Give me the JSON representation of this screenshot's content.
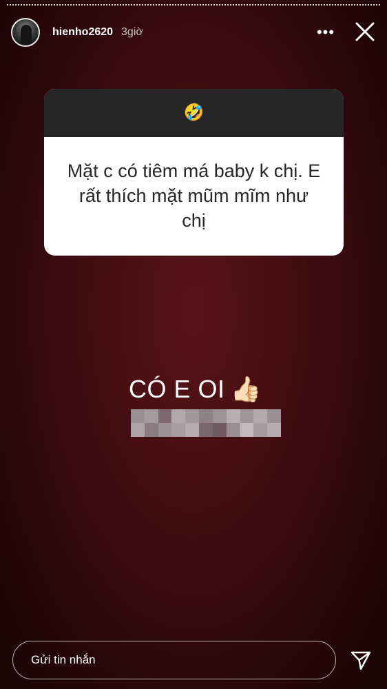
{
  "story": {
    "username": "hienho2620",
    "time": "3giờ",
    "more_label": "•••"
  },
  "question": {
    "emoji": "🤣",
    "text": "Mặt c có tiêm má baby k chị. E rất thích mặt mũm mĩm như chị"
  },
  "answer": {
    "text": "CÓ E OI",
    "emoji": "👍🏻"
  },
  "reply": {
    "placeholder": "Gửi tin nhắn"
  },
  "icons": {
    "close": "close-icon",
    "send": "send-icon",
    "more": "more-icon"
  }
}
